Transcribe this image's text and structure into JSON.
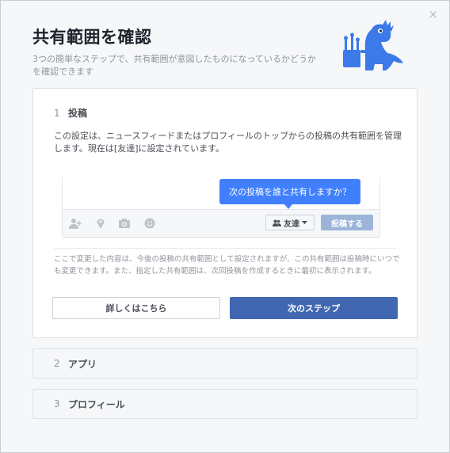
{
  "dialog": {
    "title": "共有範囲を確認",
    "subtitle": "3つの簡単なステップで、共有範囲が意図したものになっているかどうかを確認できます",
    "close_glyph": "×"
  },
  "steps": [
    {
      "number": "1",
      "label": "投稿",
      "description": "この設定は、ニュースフィードまたはプロフィールのトップからの投稿の共有範囲を管理します。現在は[友達]に設定されています。",
      "tooltip": "次の投稿を誰と共有しますか？",
      "audience_label": "友達",
      "post_button": "投稿する",
      "note": "ここで変更した内容は、今後の投稿の共有範囲として設定されますが、この共有範囲は投稿時にいつでも変更できます。また、指定した共有範囲は、次回投稿を作成するときに最初に表示されます。",
      "learn_more": "詳しくはこちら",
      "next": "次のステップ"
    },
    {
      "number": "2",
      "label": "アプリ"
    },
    {
      "number": "3",
      "label": "プロフィール"
    }
  ],
  "icons": [
    "close-icon",
    "dinosaur-mascot",
    "tag-friends-icon",
    "location-icon",
    "camera-icon",
    "feeling-icon",
    "friends-icon",
    "caret-down-icon"
  ],
  "colors": {
    "primary": "#4267b2",
    "tooltip": "#4080ff",
    "mascot": "#3b7ae8",
    "disabled": "#9cb4d8"
  }
}
